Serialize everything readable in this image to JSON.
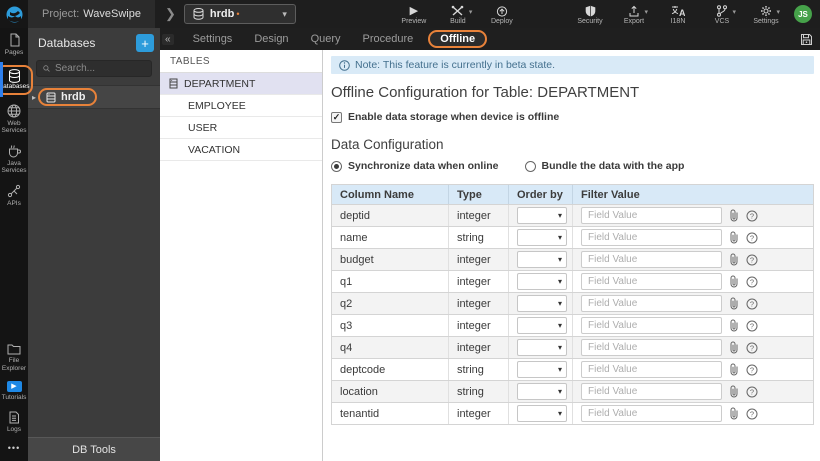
{
  "topbar": {
    "project_prefix": "Project:",
    "project_name": "WaveSwipe",
    "db_selector": "hrdb",
    "modified_marker": "•",
    "actions_left": {
      "preview": "Preview",
      "build": "Build",
      "deploy": "Deploy"
    },
    "actions_right": {
      "security": "Security",
      "export": "Export",
      "i18n": "I18N",
      "vcs": "VCS",
      "settings": "Settings"
    },
    "avatar_initials": "JS"
  },
  "icons": {
    "caret_down": "▾",
    "play": "▶",
    "expand_right": "▸",
    "collapse_left": "«",
    "check": "✓",
    "plus": "+",
    "more_dots": "•••"
  },
  "left_rail": {
    "items": [
      {
        "label": "Pages"
      },
      {
        "label": "Databases",
        "active": true
      },
      {
        "label": "Web Services"
      },
      {
        "label": "Java Services"
      },
      {
        "label": "APIs"
      },
      {
        "label": "File Explorer"
      },
      {
        "label": "Tutorials"
      },
      {
        "label": "Logs"
      }
    ]
  },
  "db_panel": {
    "title": "Databases",
    "search_placeholder": "Search...",
    "database_name": "hrdb",
    "footer": "DB Tools"
  },
  "tabs": {
    "items": [
      "Settings",
      "Design",
      "Query",
      "Procedure",
      "Offline"
    ],
    "active": "Offline"
  },
  "tables_panel": {
    "title": "TABLES",
    "items": [
      "DEPARTMENT",
      "EMPLOYEE",
      "USER",
      "VACATION"
    ],
    "selected": "DEPARTMENT"
  },
  "content": {
    "note": "Note: This feature is currently in beta state.",
    "title": "Offline Configuration for Table: DEPARTMENT",
    "enable_checkbox_label": "Enable data storage when device is offline",
    "enable_checkbox_checked": true,
    "section_title": "Data Configuration",
    "radio_options": [
      "Synchronize data when online",
      "Bundle the data with the app"
    ],
    "radio_selected": "Synchronize data when online",
    "table": {
      "headers": [
        "Column Name",
        "Type",
        "Order by",
        "Filter Value"
      ],
      "filter_placeholder": "Field Value",
      "rows": [
        {
          "name": "deptid",
          "type": "integer"
        },
        {
          "name": "name",
          "type": "string"
        },
        {
          "name": "budget",
          "type": "integer"
        },
        {
          "name": "q1",
          "type": "integer"
        },
        {
          "name": "q2",
          "type": "integer"
        },
        {
          "name": "q3",
          "type": "integer"
        },
        {
          "name": "q4",
          "type": "integer"
        },
        {
          "name": "deptcode",
          "type": "string"
        },
        {
          "name": "location",
          "type": "string"
        },
        {
          "name": "tenantid",
          "type": "integer"
        }
      ]
    }
  },
  "colors": {
    "annotation_orange": "#e8823a",
    "accent_blue": "#2d9cdb",
    "note_bg": "#d9eaf7",
    "table_header_bg": "#d8e9f7",
    "selected_table_bg": "#e1e1f1",
    "avatar_green": "#46a24a",
    "active_rail_bar": "#2f80ed"
  }
}
